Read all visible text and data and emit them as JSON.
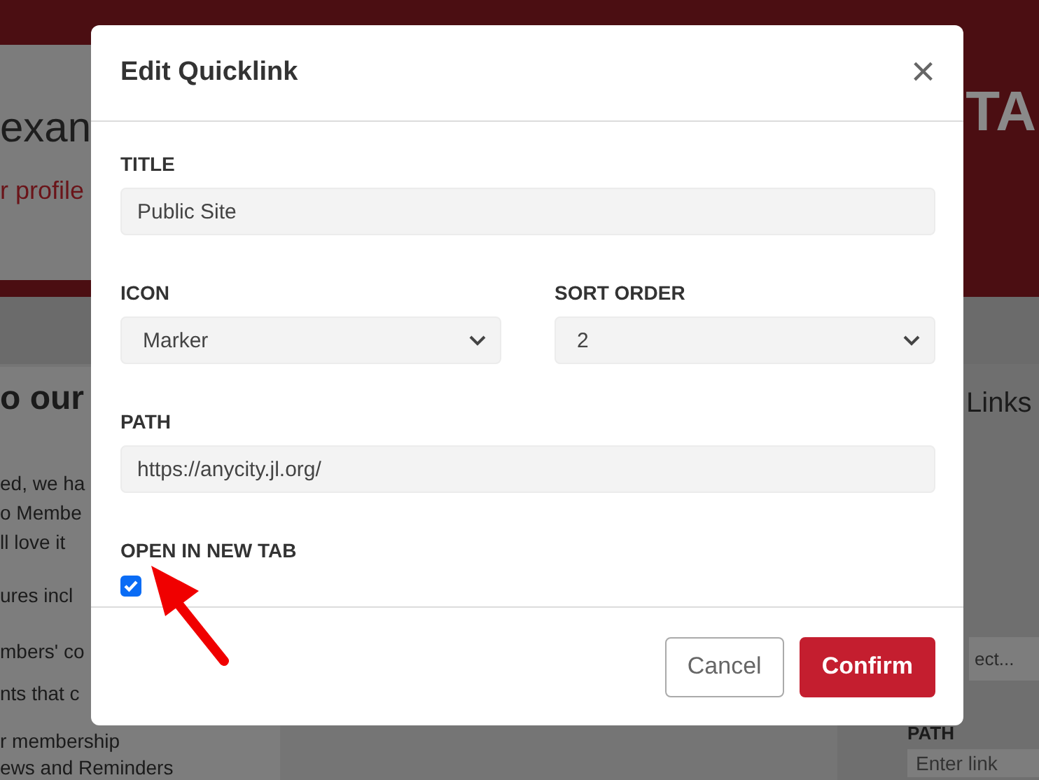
{
  "background": {
    "header": {
      "name_fragment": "exan",
      "profile_link": "r profile",
      "brand_fragment": "TA"
    },
    "content": {
      "heading": "o our",
      "paragraphs": [
        "ed, we ha",
        "o Membe",
        "ll love it"
      ],
      "features_intro": "ures incl",
      "features": [
        "mbers' co",
        "nts that c",
        "r membership",
        "ews and Reminders"
      ]
    },
    "sidebar": {
      "heading": "Links",
      "select_placeholder": "ect...",
      "path_label": "PATH",
      "path_placeholder": "Enter link"
    }
  },
  "dialog": {
    "title": "Edit Quicklink",
    "close": "×",
    "fields": [
      {
        "kind": "text",
        "label": "TITLE",
        "value": "Public Site"
      },
      {
        "kind": "select",
        "label": "ICON",
        "value": "Marker"
      },
      {
        "kind": "select",
        "label": "SORT ORDER",
        "value": "2"
      },
      {
        "kind": "text",
        "label": "PATH",
        "value": "https://anycity.jl.org/"
      },
      {
        "kind": "checkbox",
        "label": "OPEN IN NEW TAB",
        "checked": true
      }
    ],
    "buttons": [
      {
        "kind": "secondary",
        "label": "Cancel"
      },
      {
        "kind": "primary",
        "label": "Confirm"
      }
    ]
  }
}
